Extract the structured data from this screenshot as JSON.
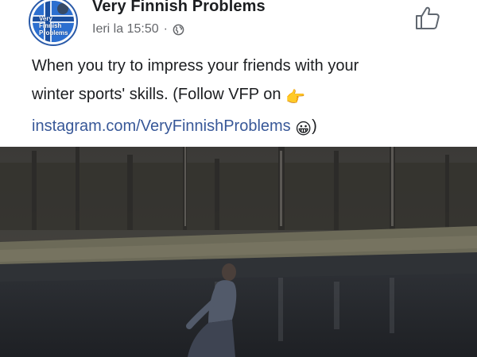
{
  "post": {
    "page_name": "Very Finnish Problems",
    "timestamp": "Ieri la 15:50",
    "separator": "·",
    "privacy_icon": "globe-icon",
    "like_icon": "thumbs-up-icon",
    "avatar_logo_text": "Very\nFinnish\nProblems",
    "caption_line1": "When you try to impress your friends with your",
    "caption_line2": "winter sports' skills. (Follow VFP on",
    "caption_emoji_point": "👉",
    "caption_link": "instagram.com/VeryFinnishProblems",
    "caption_emoji_smile": "😀",
    "caption_close": ")"
  },
  "colors": {
    "text": "#1c1e21",
    "meta": "#65676b",
    "link": "#385898",
    "avatar_blue": "#2c6fd0"
  }
}
